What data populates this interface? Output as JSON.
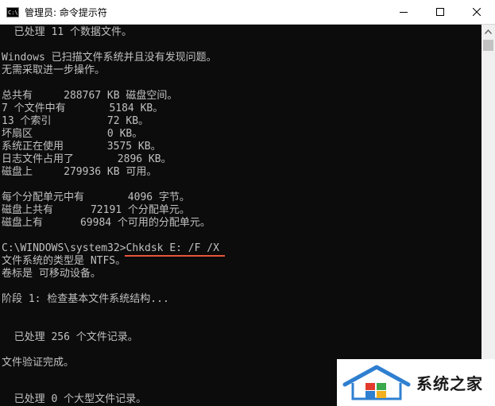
{
  "window": {
    "title": "管理员: 命令提示符",
    "app_icon_text": "C:\\"
  },
  "console": {
    "lines": [
      "  已处理 11 个数据文件。",
      "",
      "Windows 已扫描文件系统并且没有发现问题。",
      "无需采取进一步操作。",
      "",
      "总共有     288767 KB 磁盘空间。",
      "7 个文件中有       5184 KB。",
      "13 个索引         72 KB。",
      "坏扇区            0 KB。",
      "系统正在使用       3575 KB。",
      "日志文件占用了       2896 KB。",
      "磁盘上     279936 KB 可用。",
      "",
      "每个分配单元中有       4096 字节。",
      "磁盘上共有      72191 个分配单元。",
      "磁盘上有      69984 个可用的分配单元。",
      "",
      "C:\\WINDOWS\\system32>Chkdsk E: /F /X",
      "文件系统的类型是 NTFS。",
      "卷标是 可移动设备。",
      "",
      "阶段 1: 检查基本文件系统结构...",
      "",
      "",
      "  已处理 256 个文件记录。",
      "",
      "文件验证完成。",
      "",
      "",
      "  已处理 0 个大型文件记录。"
    ]
  },
  "watermark": {
    "text": "系统之家"
  },
  "icons": {
    "minimize": "minimize-icon",
    "maximize": "maximize-icon",
    "close": "close-icon",
    "scroll_up": "chevron-up-icon"
  },
  "colors": {
    "console_bg": "#0c0c0c",
    "console_text": "#c0c0c0",
    "annotation_underline": "#e8553b"
  }
}
